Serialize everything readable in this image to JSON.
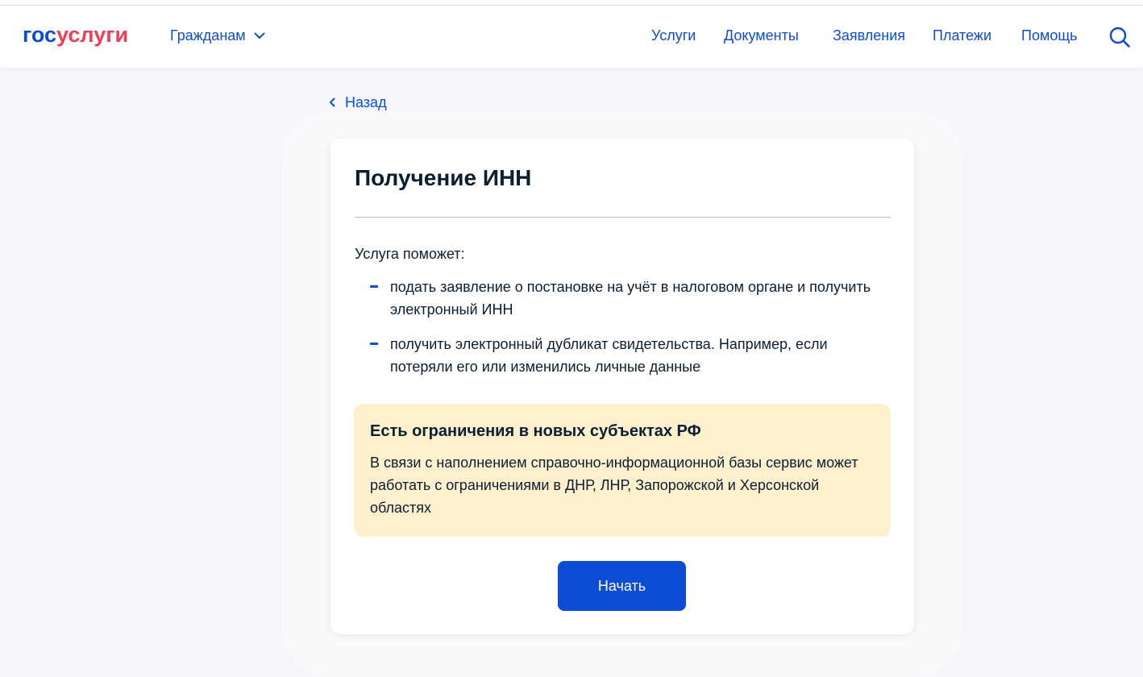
{
  "header": {
    "logo": {
      "part1": "гос",
      "part2": "услуги"
    },
    "audience_label": "Гражданам",
    "nav": [
      "Услуги",
      "Документы",
      "Заявления",
      "Платежи",
      "Помощь"
    ]
  },
  "back_label": "Назад",
  "card": {
    "title": "Получение ИНН",
    "intro": "Услуга поможет:",
    "bullets": [
      "подать заявление о постановке на учёт в налоговом органе и получить электронный ИНН",
      "получить электронный дубликат свидетельства. Например, если потеряли его или изменились личные данные"
    ],
    "notice": {
      "title": "Есть ограничения в новых субъектах РФ",
      "text": "В связи с наполнением справочно-информационной базы сервис может работать с ограничениями в ДНР, ЛНР, Запорожской и Херсонской областях"
    },
    "start_label": "Начать"
  },
  "icons": {
    "audience_chevron": "chevron-down-icon",
    "search": "search-icon",
    "back": "chevron-left-icon",
    "bullet": "dash-icon"
  },
  "colors": {
    "brand_blue": "#0d4cd3",
    "brand_red": "#ee3f58",
    "notice_bg": "#feefcd",
    "page_bg": "#f5f7fb",
    "text": "#0b1f33"
  }
}
